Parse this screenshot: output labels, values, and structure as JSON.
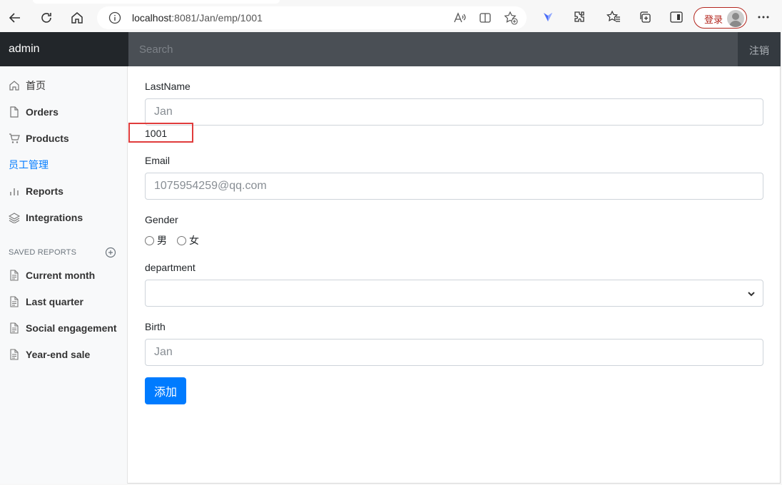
{
  "browser": {
    "url_host": "localhost",
    "url_path": ":8081/Jan/emp/1001",
    "login_label": "登录"
  },
  "topnav": {
    "brand": "admin",
    "search_placeholder": "Search",
    "signout": "注销"
  },
  "sidebar": {
    "items": [
      {
        "label": "首页",
        "icon": "home-icon"
      },
      {
        "label": "Orders",
        "icon": "file-icon"
      },
      {
        "label": "Products",
        "icon": "cart-icon"
      },
      {
        "label": "员工管理",
        "icon": "",
        "active": true
      },
      {
        "label": "Reports",
        "icon": "bar-chart-icon"
      },
      {
        "label": "Integrations",
        "icon": "layers-icon"
      }
    ],
    "saved_heading": "SAVED REPORTS",
    "saved": [
      {
        "label": "Current month"
      },
      {
        "label": "Last quarter"
      },
      {
        "label": "Social engagement"
      },
      {
        "label": "Year-end sale"
      }
    ]
  },
  "form": {
    "lastname_label": "LastName",
    "lastname_placeholder": "Jan",
    "emp_id": "1001",
    "email_label": "Email",
    "email_placeholder": "1075954259@qq.com",
    "gender_label": "Gender",
    "gender_options": [
      "男",
      "女"
    ],
    "department_label": "department",
    "department_value": "",
    "birth_label": "Birth",
    "birth_placeholder": "Jan",
    "submit_label": "添加"
  },
  "colors": {
    "primary": "#007bff",
    "navbar": "#343a40",
    "highlight": "#e03c3c"
  }
}
